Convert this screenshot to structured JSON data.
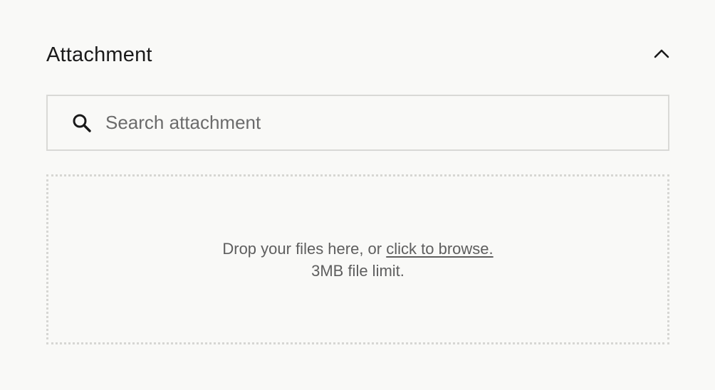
{
  "section": {
    "title": "Attachment",
    "collapse_icon": "chevron-up-icon"
  },
  "search": {
    "icon": "search-icon",
    "placeholder": "Search attachment",
    "value": ""
  },
  "dropzone": {
    "prompt": "Drop your files here, or",
    "link_label": "click to browse.",
    "limit": "3MB file limit."
  }
}
